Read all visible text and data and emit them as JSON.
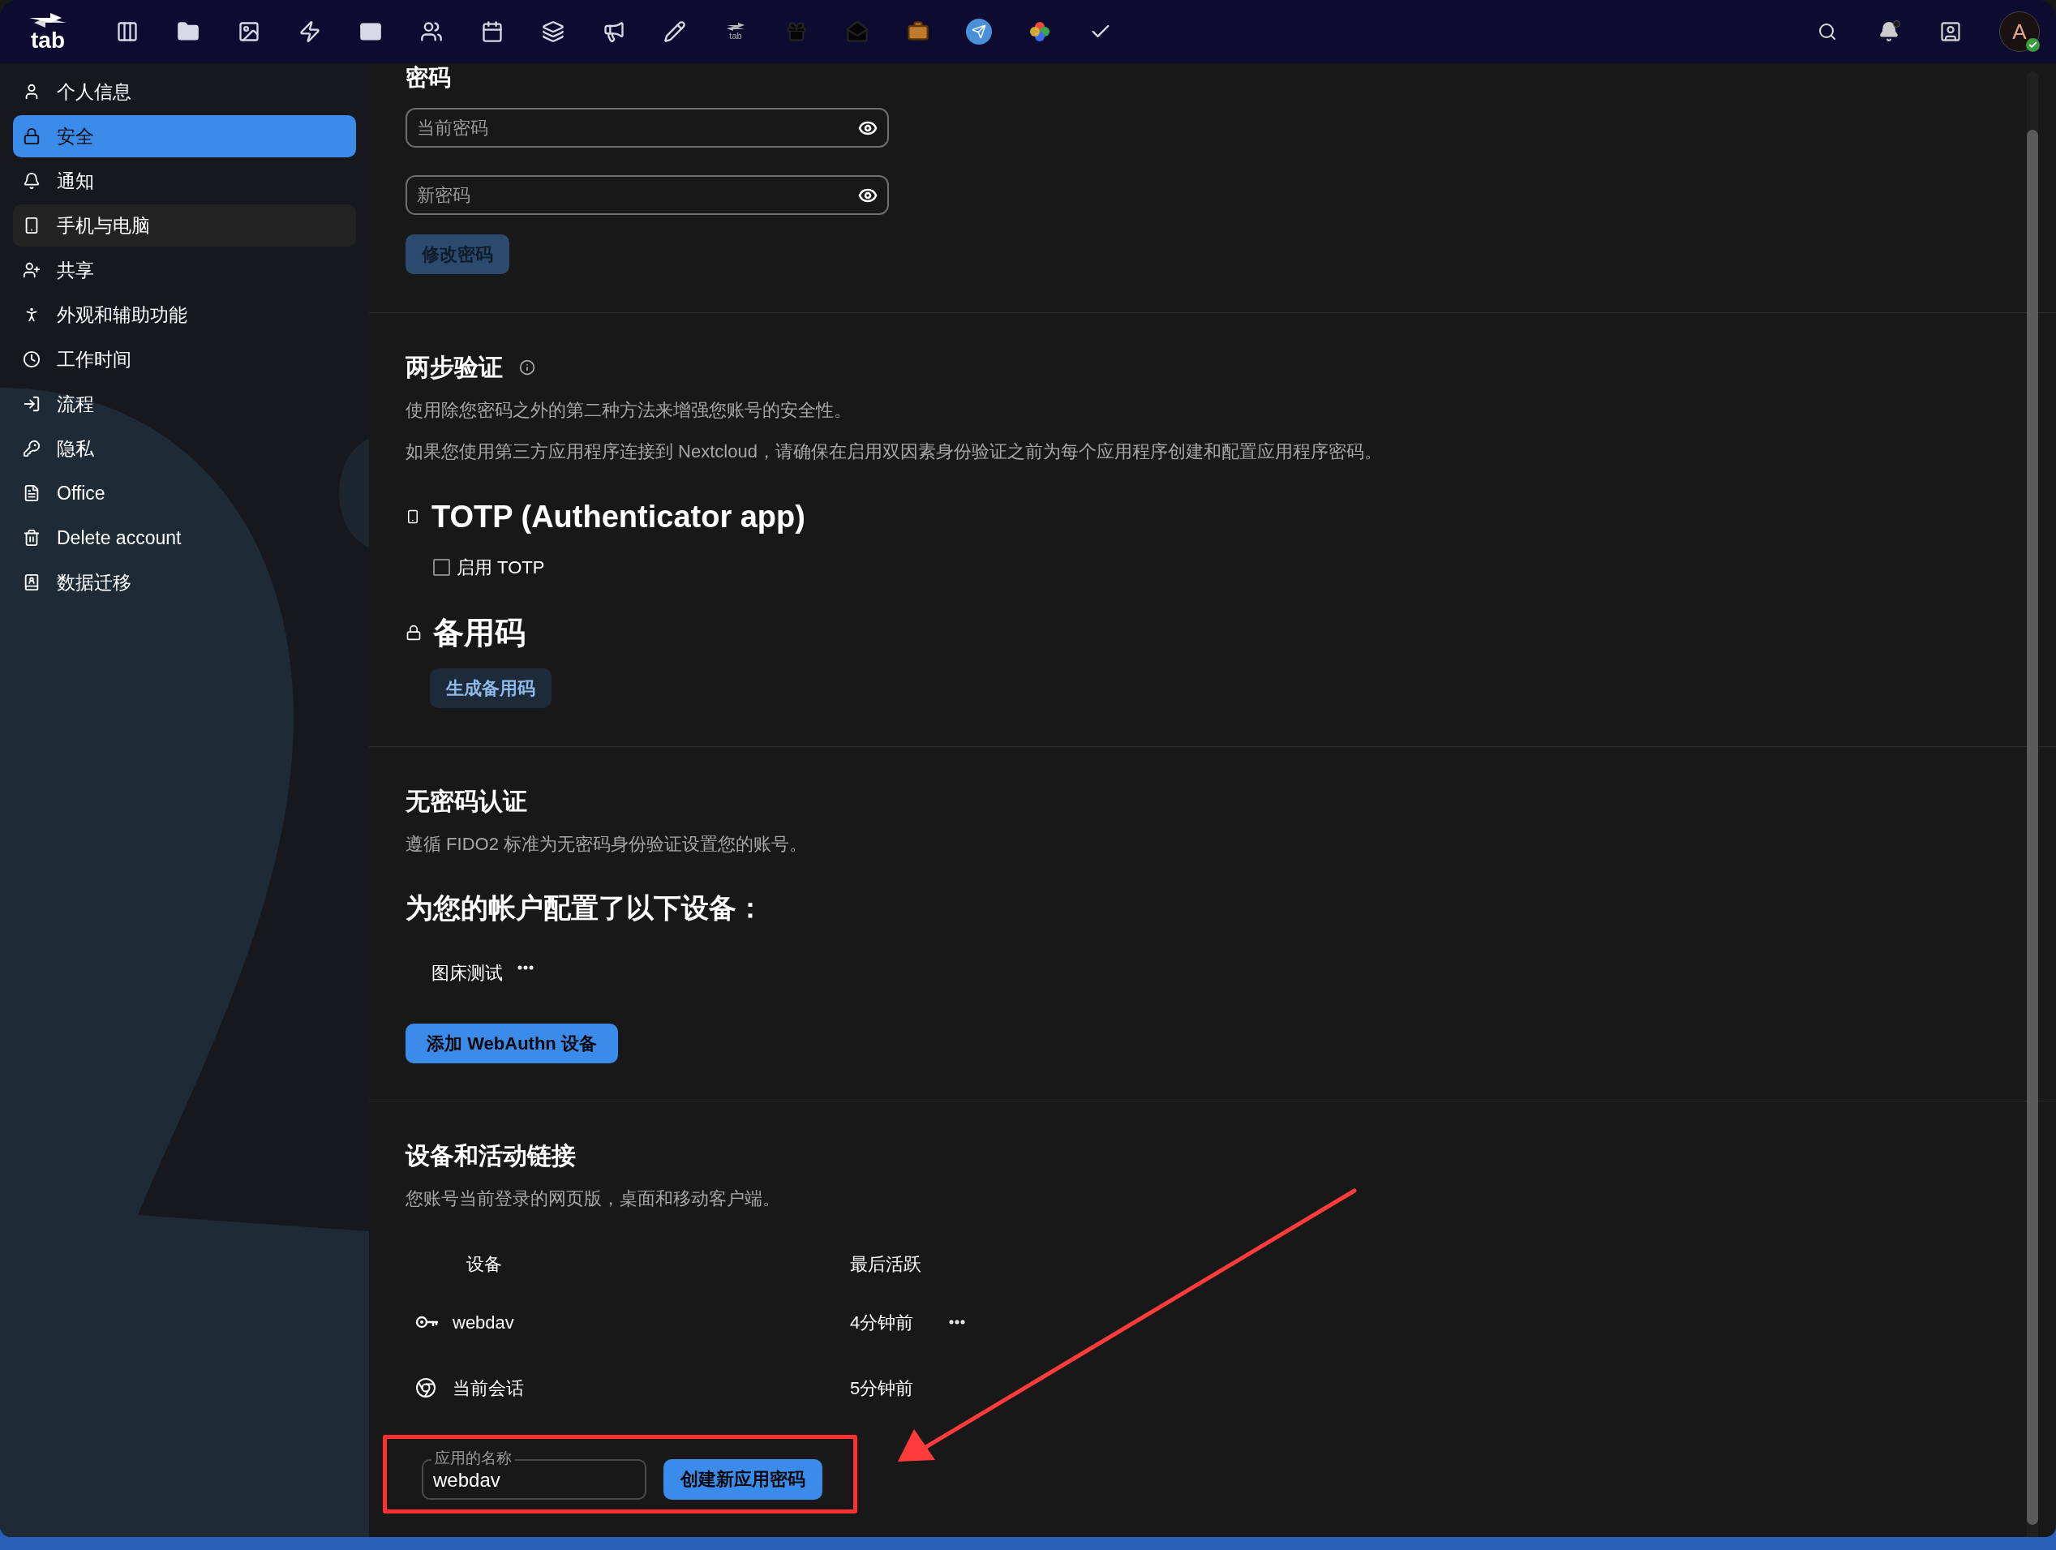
{
  "top_bar": {
    "logo_text": "tab",
    "app_badge_text": "tab",
    "notifications_unread": true,
    "avatar": {
      "letter": "A",
      "online": true
    }
  },
  "sidebar": {
    "items": [
      {
        "label": "个人信息",
        "selected": false,
        "hovered": false
      },
      {
        "label": "安全",
        "selected": true,
        "hovered": false
      },
      {
        "label": "通知",
        "selected": false,
        "hovered": false
      },
      {
        "label": "手机与电脑",
        "selected": false,
        "hovered": true
      },
      {
        "label": "共享",
        "selected": false,
        "hovered": false
      },
      {
        "label": "外观和辅助功能",
        "selected": false,
        "hovered": false
      },
      {
        "label": "工作时间",
        "selected": false,
        "hovered": false
      },
      {
        "label": "流程",
        "selected": false,
        "hovered": false
      },
      {
        "label": "隐私",
        "selected": false,
        "hovered": false
      },
      {
        "label": "Office",
        "selected": false,
        "hovered": false
      },
      {
        "label": "Delete account",
        "selected": false,
        "hovered": false
      },
      {
        "label": "数据迁移",
        "selected": false,
        "hovered": false
      }
    ]
  },
  "password": {
    "heading": "密码",
    "fields": [
      {
        "placeholder": "当前密码"
      },
      {
        "placeholder": "新密码"
      }
    ],
    "button": "修改密码"
  },
  "two_factor": {
    "heading": "两步验证",
    "descriptions": [
      "使用除您密码之外的第二种方法来增强您账号的安全性。",
      "如果您使用第三方应用程序连接到 Nextcloud，请确保在启用双因素身份验证之前为每个应用程序创建和配置应用程序密码。"
    ],
    "totp": {
      "heading": "TOTP (Authenticator app)",
      "checkbox_label": "启用 TOTP",
      "checked": false
    },
    "backup": {
      "heading": "备用码",
      "button": "生成备用码"
    }
  },
  "passwordless": {
    "heading": "无密码认证",
    "description": "遵循 FIDO2 标准为无密码身份验证设置您的账号。",
    "devices_heading": "为您的帐户配置了以下设备：",
    "devices": [
      {
        "name": "图床测试"
      }
    ],
    "button": "添加 WebAuthn 设备"
  },
  "sessions": {
    "heading": "设备和活动链接",
    "description": "您账号当前登录的网页版，桌面和移动客户端。",
    "columns": [
      "设备",
      "最后活跃"
    ],
    "rows": [
      {
        "kind": "app_password",
        "name": "webdav",
        "last_active": "4分钟前",
        "has_menu": true
      },
      {
        "kind": "browser",
        "name": "当前会话",
        "last_active": "5分钟前",
        "has_menu": false
      }
    ],
    "app_name_field": {
      "label": "应用的名称",
      "value": "webdav"
    },
    "create_button": "创建新应用密码"
  },
  "annotations": {
    "highlight_box": true,
    "arrow": true
  }
}
